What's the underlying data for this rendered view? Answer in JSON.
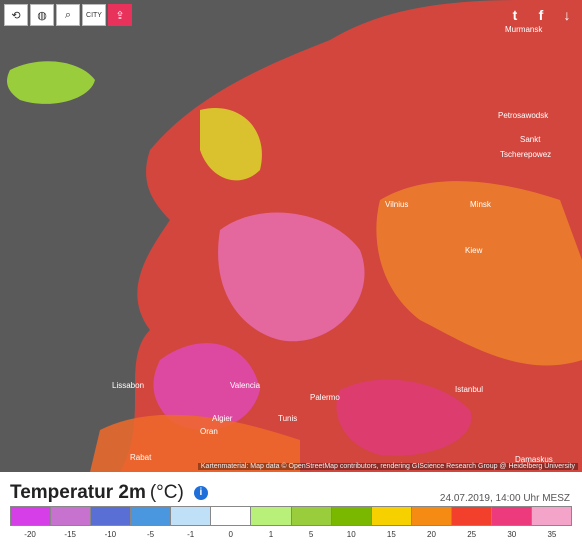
{
  "toolbar": {
    "refresh_icon": "refresh-icon",
    "globe_icon": "globe-icon",
    "zoom_icon": "zoom-icon",
    "city_label": "CITY",
    "share_icon": "share-icon"
  },
  "social": {
    "twitter": "t",
    "facebook": "f",
    "download": "↓"
  },
  "cities": [
    "Murmansk",
    "Petrosawodsk",
    "Tscherepowez",
    "Vilnius",
    "Minsk",
    "Kiew",
    "Istanbul",
    "Valencia",
    "Algier",
    "Tunis",
    "Palermo",
    "Rabat",
    "Oran",
    "Damaskus",
    "Sankt",
    "Lissabon"
  ],
  "attribution": "Kartenmaterial: Map data © OpenStreetMap contributors, rendering GIScience Research Group @ Heidelberg University",
  "legend": {
    "title": "Temperatur 2m",
    "unit": "(°C)",
    "info": "i",
    "timestamp": "24.07.2019, 14:00 Uhr MESZ",
    "colors": [
      "#d63ee8",
      "#c872d0",
      "#5a6fd6",
      "#4a97e0",
      "#bfe0f7",
      "#ffffff",
      "#b8f07a",
      "#9acd3c",
      "#7ab800",
      "#f7d000",
      "#f58b12",
      "#f2402c",
      "#ec3a7c",
      "#f4a4c8"
    ],
    "ticks": [
      "-20",
      "-15",
      "-10",
      "-5",
      "-1",
      "0",
      "1",
      "5",
      "10",
      "15",
      "20",
      "25",
      "30",
      "35"
    ]
  },
  "colors": {
    "map_bg": "#5a5a5a",
    "accent_red": "#e8315b"
  }
}
